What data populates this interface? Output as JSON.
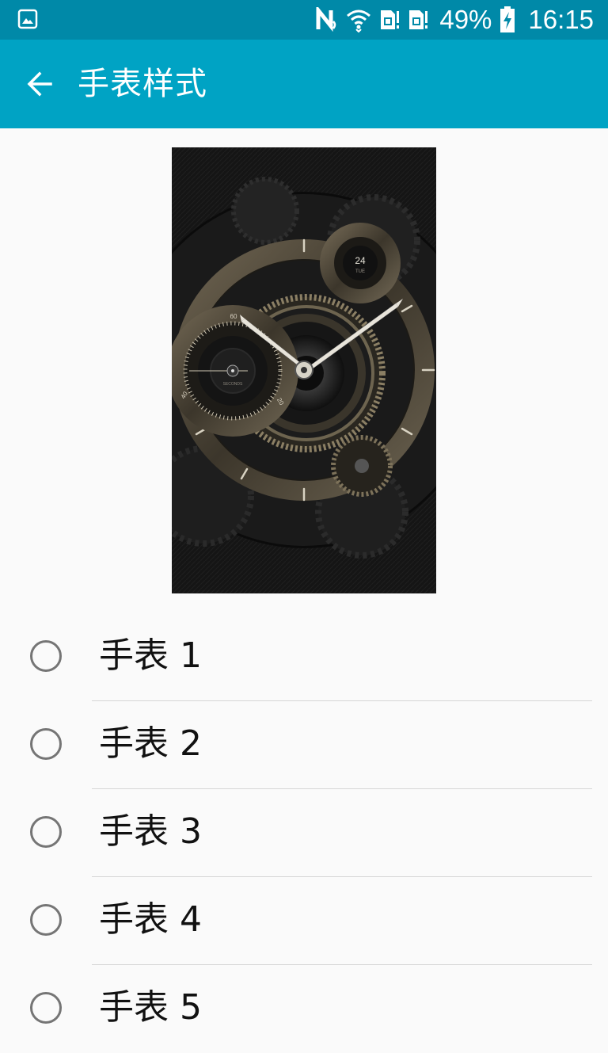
{
  "status_bar": {
    "battery": "49%",
    "time": "16:15",
    "icons": [
      "gallery-icon",
      "nfc-icon",
      "wifi-icon",
      "sim1-icon",
      "sim2-icon",
      "battery-charging-icon"
    ]
  },
  "app_bar": {
    "title": "手表样式",
    "back_icon": "arrow-left-icon"
  },
  "preview": {
    "date_day": "24",
    "date_weekday": "TUE",
    "seconds_label": "SECONDS",
    "sub_dial_numbers": [
      "60",
      "20",
      "40"
    ]
  },
  "options": [
    {
      "label": "手表 1",
      "selected": false
    },
    {
      "label": "手表 2",
      "selected": false
    },
    {
      "label": "手表 3",
      "selected": false
    },
    {
      "label": "手表 4",
      "selected": false
    },
    {
      "label": "手表 5",
      "selected": false
    }
  ],
  "colors": {
    "status_bar": "#0089a8",
    "app_bar": "#00a3c4",
    "background": "#fafafa",
    "radio_outline": "#757575",
    "divider": "#d6d6d6"
  }
}
